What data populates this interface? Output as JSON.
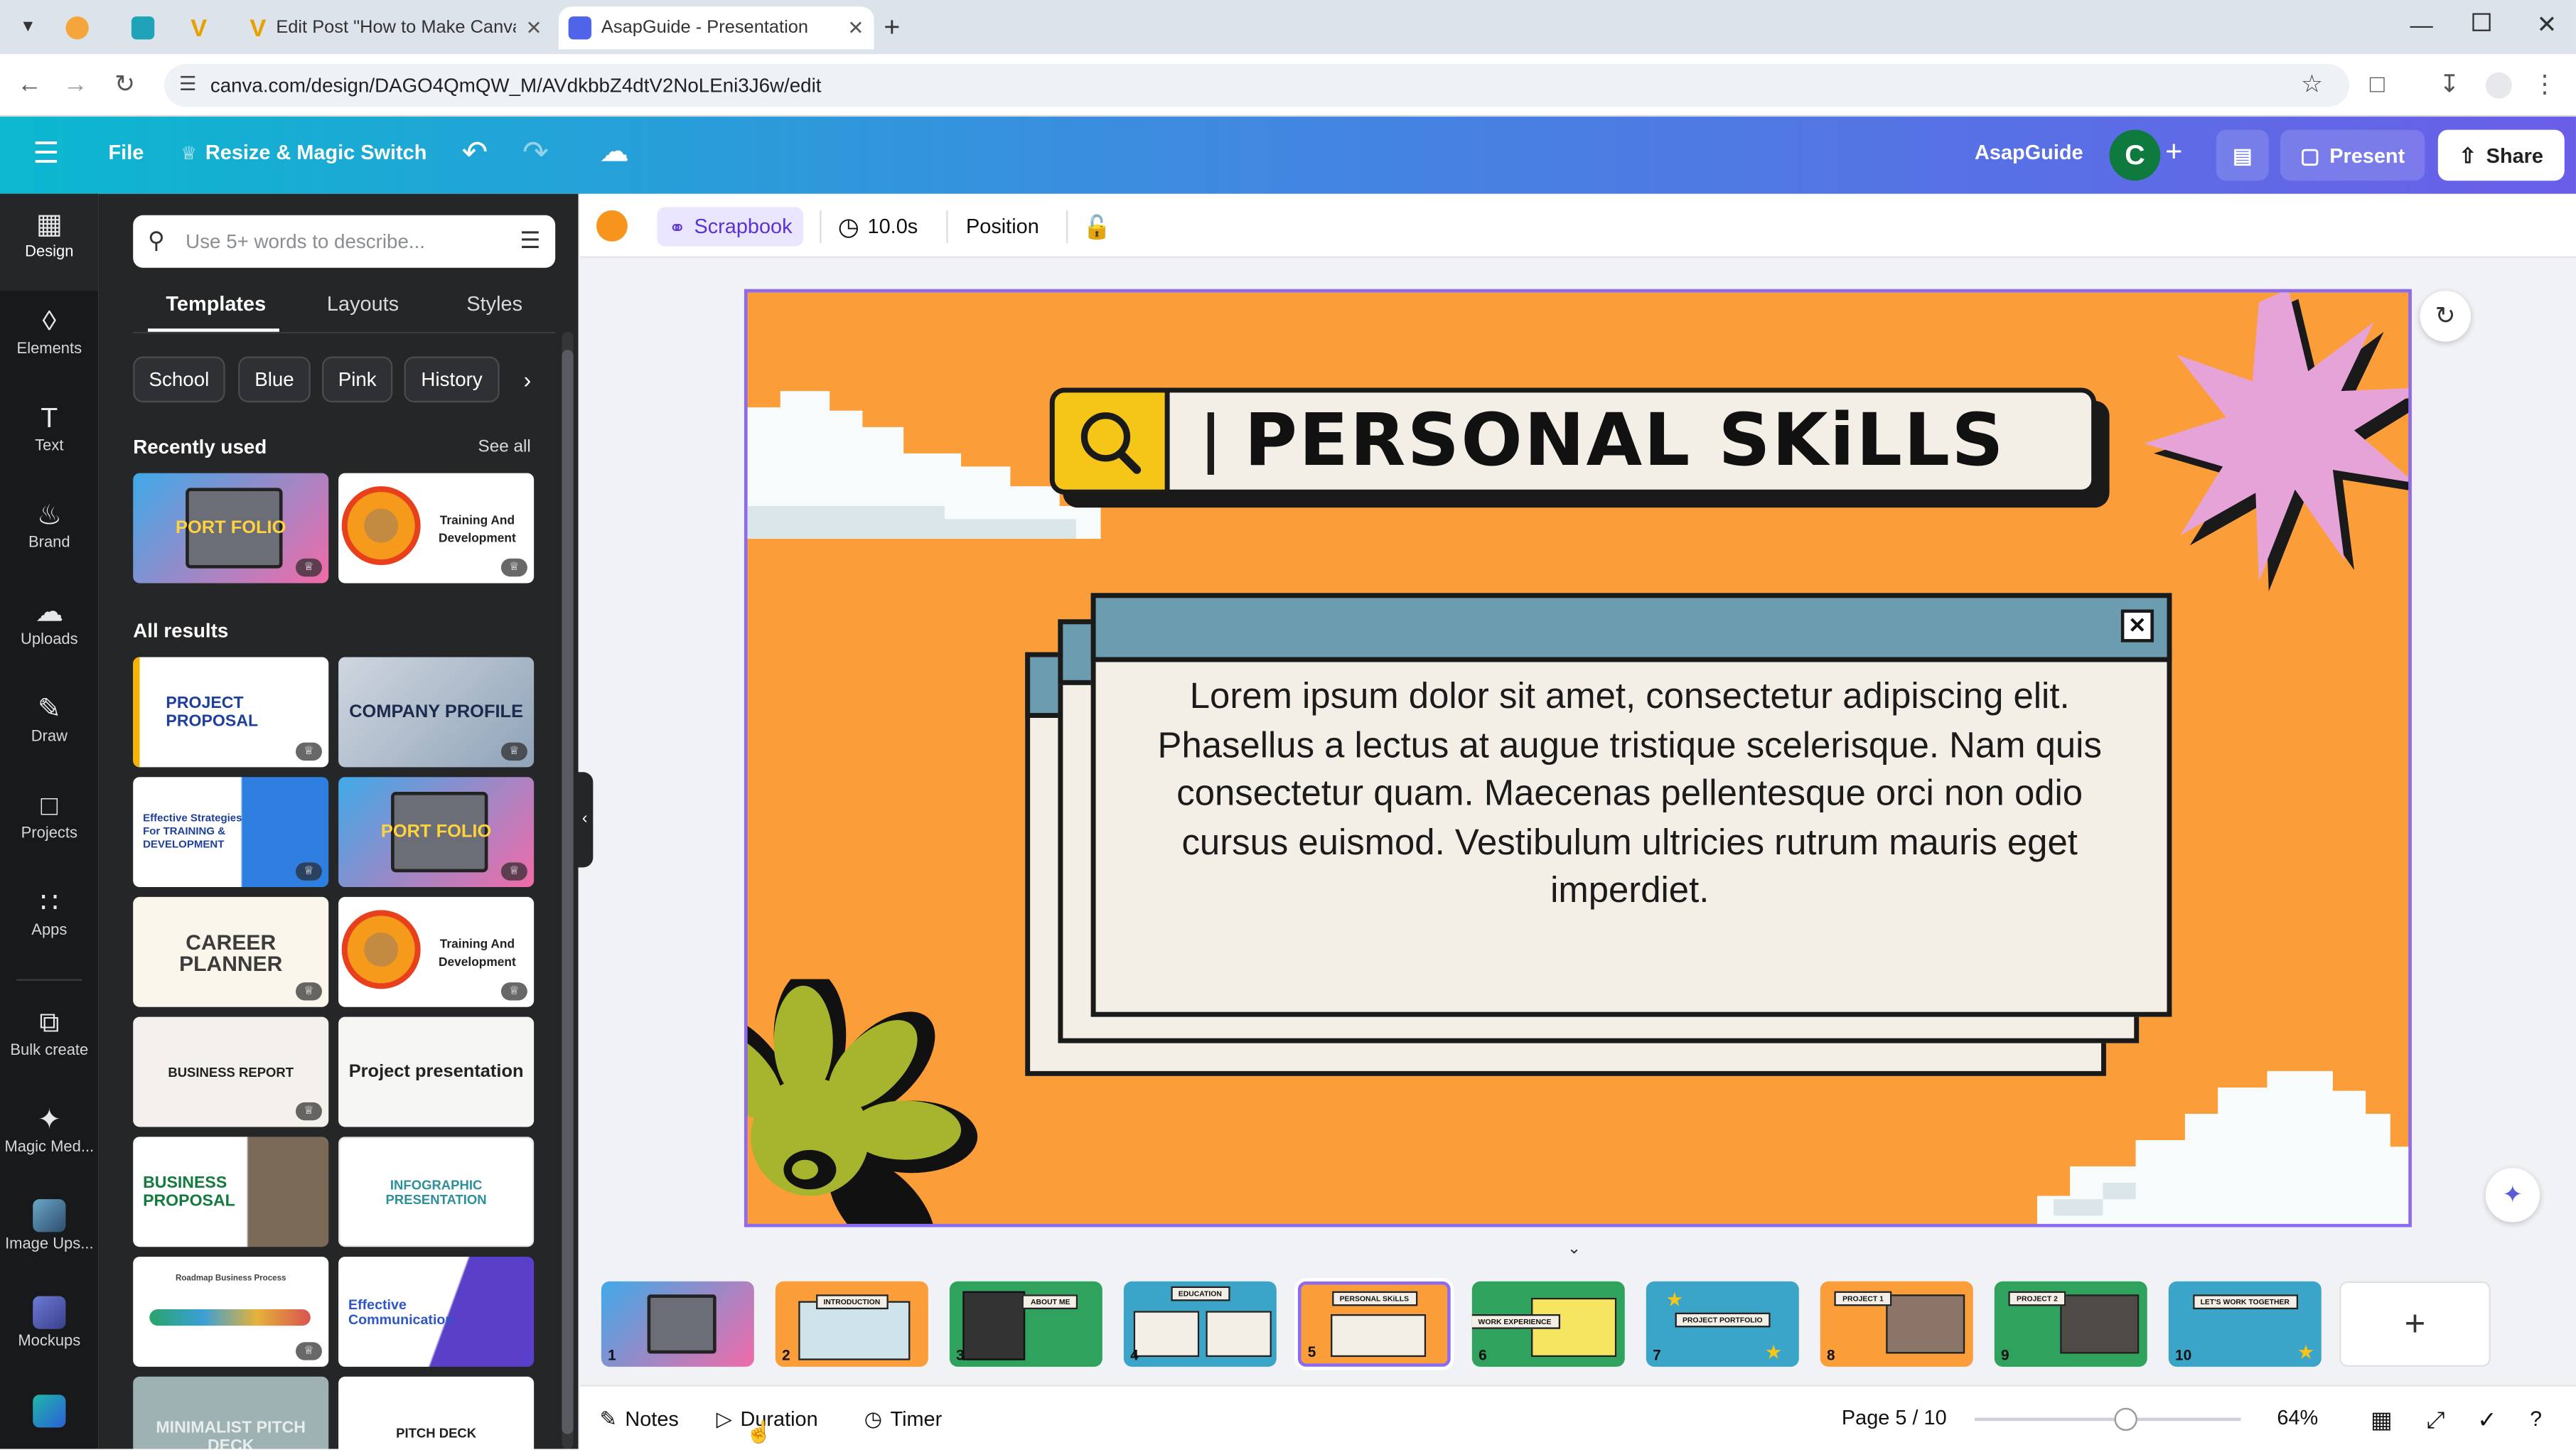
{
  "browser": {
    "tabs": [
      {
        "title": ""
      },
      {
        "title": ""
      },
      {
        "title": ""
      },
      {
        "title": "Edit Post \"How to Make Canva"
      },
      {
        "title": "AsapGuide - Presentation"
      }
    ],
    "url": "canva.com/design/DAGO4QmQW_M/AVdkbbZ4dtV2NoLEni3J6w/edit"
  },
  "header": {
    "file_label": "File",
    "resize_label": "Resize & Magic Switch",
    "team_name": "AsapGuide",
    "avatar_letter": "C",
    "present_label": "Present",
    "share_label": "Share"
  },
  "rail": {
    "items": [
      {
        "label": "Design"
      },
      {
        "label": "Elements"
      },
      {
        "label": "Text"
      },
      {
        "label": "Brand"
      },
      {
        "label": "Uploads"
      },
      {
        "label": "Draw"
      },
      {
        "label": "Projects"
      },
      {
        "label": "Apps"
      },
      {
        "label": "Bulk create"
      },
      {
        "label": "Magic Med..."
      },
      {
        "label": "Image Ups..."
      },
      {
        "label": "Mockups"
      }
    ]
  },
  "panel": {
    "search_placeholder": "Use 5+ words to describe...",
    "tabs": [
      "Templates",
      "Layouts",
      "Styles"
    ],
    "chips": [
      "School",
      "Blue",
      "Pink",
      "History"
    ],
    "recently_used_label": "Recently used",
    "see_all_label": "See all",
    "all_results_label": "All results",
    "recent": [
      {
        "text": "PORT FOLIO"
      },
      {
        "text": "Training And Development"
      }
    ],
    "results": [
      {
        "text": "PROJECT PROPOSAL"
      },
      {
        "text": "COMPANY PROFILE"
      },
      {
        "text": "Effective Strategies For TRAINING & DEVELOPMENT"
      },
      {
        "text": "PORT FOLIO"
      },
      {
        "text": "CAREER PLANNER"
      },
      {
        "text": "Training And Development"
      },
      {
        "text": "BUSINESS REPORT"
      },
      {
        "text": "Project presentation"
      },
      {
        "text": "BUSINESS PROPOSAL"
      },
      {
        "text": "INFOGRAPHIC PRESENTATION"
      },
      {
        "text": "Roadmap Business Process"
      },
      {
        "text": "Effective Communication"
      },
      {
        "text": "MINIMALIST PITCH DECK"
      },
      {
        "text": "PITCH DECK"
      }
    ]
  },
  "toolbar": {
    "style_label": "Scrapbook",
    "duration_value": "10.0s",
    "position_label": "Position",
    "color": "#f7941d"
  },
  "slide": {
    "title": "PERSONAL SKiLLS",
    "body": "Lorem ipsum dolor sit amet, consectetur adipiscing elit. Phasellus a lectus at augue tristique scelerisque. Nam quis consectetur quam. Maecenas pellentesque orci non odio cursus euismod. Vestibulum ultricies rutrum mauris eget imperdiet."
  },
  "filmstrip": {
    "pages": [
      {
        "num": "1",
        "label": ""
      },
      {
        "num": "2",
        "label": "INTRODUCTION"
      },
      {
        "num": "3",
        "label": "ABOUT ME"
      },
      {
        "num": "4",
        "label": "EDUCATION"
      },
      {
        "num": "5",
        "label": "PERSONAL SKiLLS"
      },
      {
        "num": "6",
        "label": "WORK EXPERIENCE"
      },
      {
        "num": "7",
        "label": "PROJECT PORTFOLIO"
      },
      {
        "num": "8",
        "label": "PROJECT 1"
      },
      {
        "num": "9",
        "label": "PROJECT 2"
      },
      {
        "num": "10",
        "label": "LET'S WORK TOGETHER"
      }
    ],
    "add_label": "+"
  },
  "bottom": {
    "notes_label": "Notes",
    "duration_label": "Duration",
    "timer_label": "Timer",
    "page_indicator": "Page 5 / 10",
    "zoom_value": "64%",
    "zoom_level": 64
  },
  "colors": {
    "slide_bg": "#fb9e3a",
    "selection": "#8b6bf2",
    "rail_bg": "#18191b",
    "panel_bg": "#252627"
  }
}
